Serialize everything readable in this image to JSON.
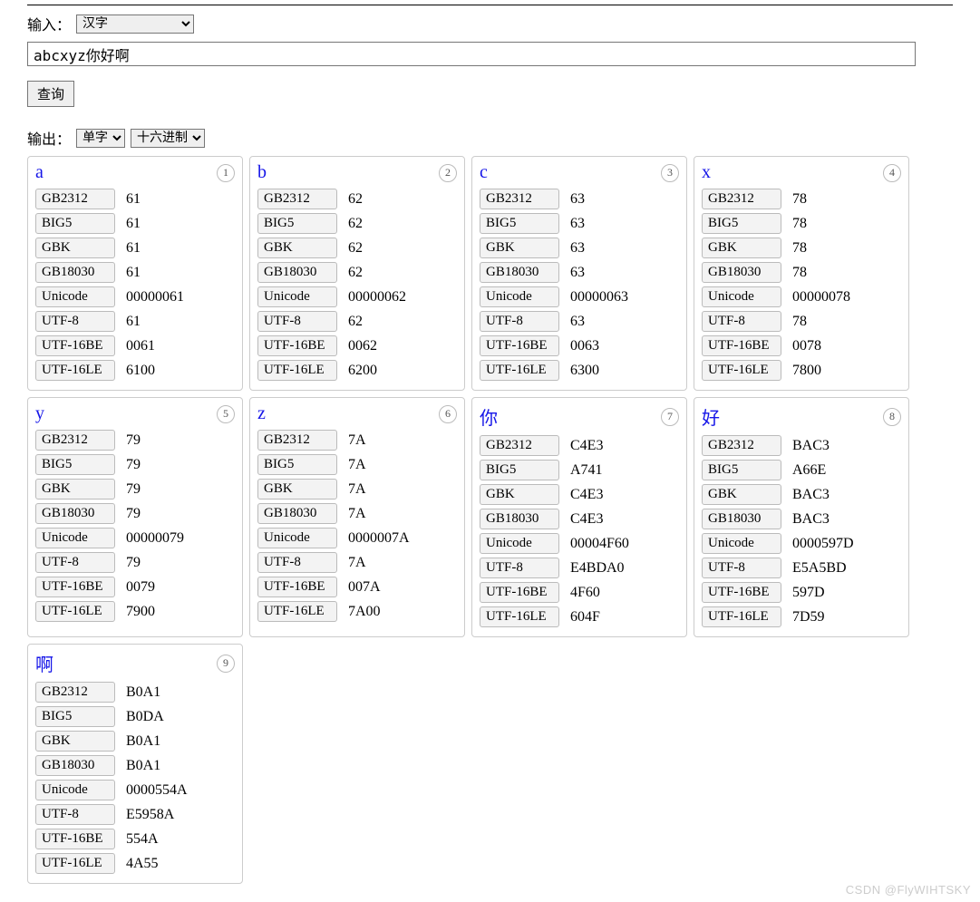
{
  "input": {
    "label": "输入：",
    "select_value": "汉字",
    "text_value": "abcxyz你好啊"
  },
  "query_button": "查询",
  "output": {
    "label": "输出：",
    "mode_value": "单字",
    "radix_value": "十六进制"
  },
  "encodings": [
    "GB2312",
    "BIG5",
    "GBK",
    "GB18030",
    "Unicode",
    "UTF-8",
    "UTF-16BE",
    "UTF-16LE"
  ],
  "cards": [
    {
      "char": "a",
      "index": "1",
      "values": [
        "61",
        "61",
        "61",
        "61",
        "00000061",
        "61",
        "0061",
        "6100"
      ]
    },
    {
      "char": "b",
      "index": "2",
      "values": [
        "62",
        "62",
        "62",
        "62",
        "00000062",
        "62",
        "0062",
        "6200"
      ]
    },
    {
      "char": "c",
      "index": "3",
      "values": [
        "63",
        "63",
        "63",
        "63",
        "00000063",
        "63",
        "0063",
        "6300"
      ]
    },
    {
      "char": "x",
      "index": "4",
      "values": [
        "78",
        "78",
        "78",
        "78",
        "00000078",
        "78",
        "0078",
        "7800"
      ]
    },
    {
      "char": "y",
      "index": "5",
      "values": [
        "79",
        "79",
        "79",
        "79",
        "00000079",
        "79",
        "0079",
        "7900"
      ]
    },
    {
      "char": "z",
      "index": "6",
      "values": [
        "7A",
        "7A",
        "7A",
        "7A",
        "0000007A",
        "7A",
        "007A",
        "7A00"
      ]
    },
    {
      "char": "你",
      "index": "7",
      "values": [
        "C4E3",
        "A741",
        "C4E3",
        "C4E3",
        "00004F60",
        "E4BDA0",
        "4F60",
        "604F"
      ]
    },
    {
      "char": "好",
      "index": "8",
      "values": [
        "BAC3",
        "A66E",
        "BAC3",
        "BAC3",
        "0000597D",
        "E5A5BD",
        "597D",
        "7D59"
      ]
    },
    {
      "char": "啊",
      "index": "9",
      "values": [
        "B0A1",
        "B0DA",
        "B0A1",
        "B0A1",
        "0000554A",
        "E5958A",
        "554A",
        "4A55"
      ]
    }
  ],
  "watermark": "CSDN @FlyWIHTSKY"
}
